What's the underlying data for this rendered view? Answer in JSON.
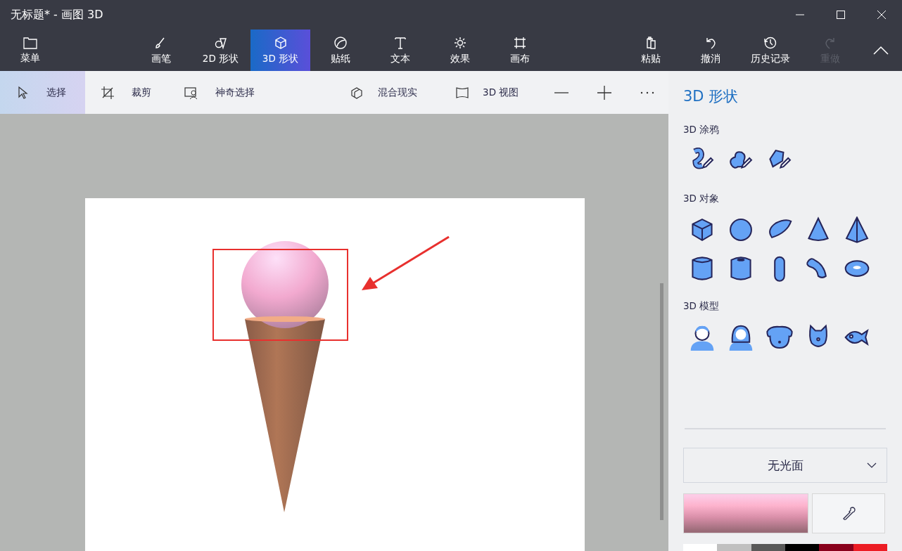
{
  "window": {
    "title": "无标题* - 画图 3D"
  },
  "ribbon": {
    "menu": {
      "label": "菜单"
    },
    "tools": [
      {
        "label": "画笔",
        "selected": false
      },
      {
        "label": "2D 形状",
        "selected": false
      },
      {
        "label": "3D 形状",
        "selected": true
      },
      {
        "label": "贴纸",
        "selected": false
      },
      {
        "label": "文本",
        "selected": false
      },
      {
        "label": "效果",
        "selected": false
      },
      {
        "label": "画布",
        "selected": false
      }
    ],
    "actions": [
      {
        "label": "粘贴",
        "disabled": false
      },
      {
        "label": "撤消",
        "disabled": false
      },
      {
        "label": "历史记录",
        "disabled": false
      },
      {
        "label": "重做",
        "disabled": true
      }
    ]
  },
  "toolbar": {
    "tools": [
      {
        "label": "选择",
        "selected": true
      },
      {
        "label": "裁剪",
        "selected": false
      },
      {
        "label": "神奇选择",
        "selected": false
      }
    ],
    "views": [
      {
        "label": "混合现实"
      },
      {
        "label": "3D 视图"
      }
    ]
  },
  "panel": {
    "title": "3D 形状",
    "sections": [
      {
        "kind": "doodle",
        "heading": "3D 涂鸦"
      },
      {
        "kind": "objects",
        "heading": "3D 对象"
      },
      {
        "kind": "models",
        "heading": "3D 模型"
      }
    ],
    "material": {
      "value": "无光面"
    },
    "current_color": {
      "color": "#d98fa9"
    },
    "palette": [
      {
        "color": "#ffffff"
      },
      {
        "color": "#c0c0c0"
      },
      {
        "color": "#595959"
      },
      {
        "color": "#000000"
      },
      {
        "color": "#88001b"
      },
      {
        "color": "#ec1c24"
      }
    ]
  }
}
